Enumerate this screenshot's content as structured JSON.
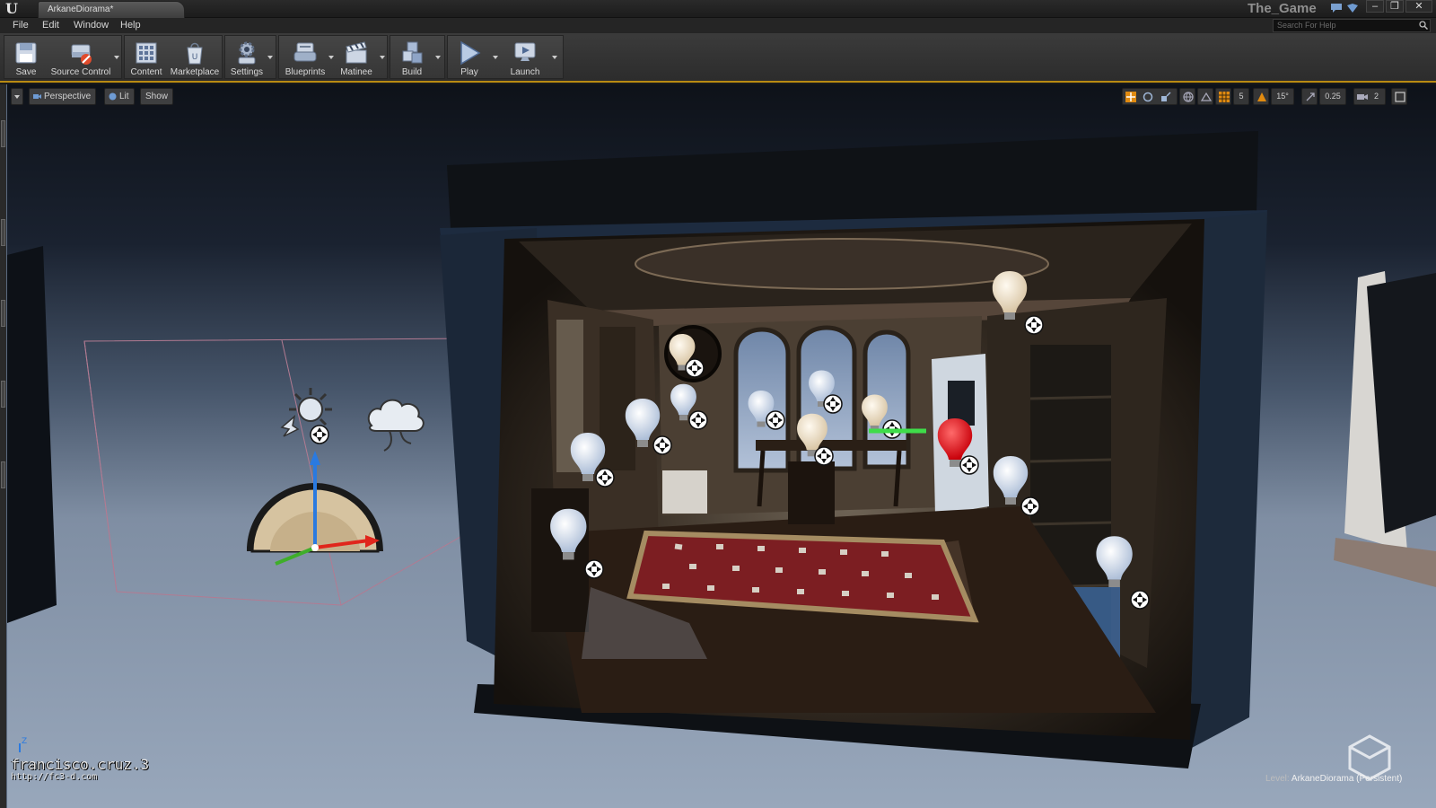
{
  "window": {
    "tab_title": "ArkaneDiorama*",
    "project_name": "The_Game",
    "buttons": {
      "minimize": "–",
      "restore": "❐",
      "close": "✕"
    }
  },
  "menu": {
    "items": [
      {
        "label": "File"
      },
      {
        "label": "Edit"
      },
      {
        "label": "Window"
      },
      {
        "label": "Help"
      }
    ],
    "search_placeholder": "Search For Help"
  },
  "toolbar": {
    "items": [
      {
        "label": "Save",
        "icon": "save-icon"
      },
      {
        "label": "Source Control",
        "icon": "source-control-icon"
      },
      {
        "label": "Content",
        "icon": "content-icon"
      },
      {
        "label": "Marketplace",
        "icon": "marketplace-icon"
      },
      {
        "label": "Settings",
        "icon": "settings-icon"
      },
      {
        "label": "Blueprints",
        "icon": "blueprints-icon"
      },
      {
        "label": "Matinee",
        "icon": "matinee-icon"
      },
      {
        "label": "Build",
        "icon": "build-icon"
      },
      {
        "label": "Play",
        "icon": "play-icon"
      },
      {
        "label": "Launch",
        "icon": "launch-icon"
      }
    ]
  },
  "viewport": {
    "view_mode": "Perspective",
    "lighting_mode": "Lit",
    "show_label": "Show",
    "grid_snap": "5",
    "rotation_snap": "15°",
    "scale_snap": "0.25",
    "camera_speed": "2",
    "watermark": "francisco.cruz.3",
    "watermark_url": "http://fc3-d.com",
    "axis_label": "Z",
    "level_key": "Level:",
    "level_value": "ArkaneDiorama (Persistent)"
  },
  "colors": {
    "accent": "#b88a12",
    "selected_light": "#e0141c",
    "gizmo_x": "#e0261c",
    "gizmo_y": "#3fae2a",
    "gizmo_z": "#2a7ae0",
    "bulb": "#c9d6e6",
    "bulb_warm": "#e7d9c2"
  }
}
